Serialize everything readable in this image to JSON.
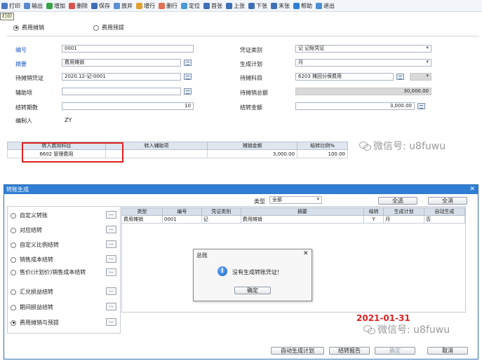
{
  "toolbar": {
    "items": [
      {
        "icon": "print-icon",
        "label": "打印",
        "color": "#4a78c2"
      },
      {
        "icon": "export-icon",
        "label": "输出",
        "color": "#5a88cf"
      },
      {
        "icon": "add-icon",
        "label": "增加",
        "color": "#3aa34a"
      },
      {
        "icon": "delete-icon",
        "label": "删除",
        "color": "#d9534f"
      },
      {
        "icon": "save-icon",
        "label": "保存",
        "color": "#3d6db5"
      },
      {
        "icon": "discard-icon",
        "label": "放弃",
        "color": "#5b8fd0"
      },
      {
        "icon": "add-row-icon",
        "label": "增行",
        "color": "#e0a030"
      },
      {
        "icon": "delete-row-icon",
        "label": "删行",
        "color": "#e07050"
      },
      {
        "icon": "locate-icon",
        "label": "定位",
        "color": "#4a9ad8"
      },
      {
        "icon": "first-icon",
        "label": "首张",
        "color": "#3f6fb8"
      },
      {
        "icon": "prev-icon",
        "label": "上张",
        "color": "#3f6fb8"
      },
      {
        "icon": "next-icon",
        "label": "下张",
        "color": "#3f6fb8"
      },
      {
        "icon": "last-icon",
        "label": "末张",
        "color": "#3f6fb8"
      },
      {
        "icon": "help-icon",
        "label": "帮助",
        "color": "#2d7fd4"
      },
      {
        "icon": "exit-icon",
        "label": "退出",
        "color": "#4a8fd4"
      }
    ],
    "tooltip": "打印"
  },
  "form": {
    "radio_amortize": "费用摊销",
    "radio_accrual": "费用预提",
    "labels": {
      "code": "编号",
      "summary": "摘要",
      "pending_voucher": "待摊销凭证",
      "aux": "辅助项",
      "periods": "结转期数",
      "maker": "编制人",
      "voucher_type": "凭证类别",
      "plan": "生成计划",
      "pending_subject": "待摊科目",
      "pending_total": "待摊销总额",
      "transfer_amount": "结转金额"
    },
    "values": {
      "code": "0001",
      "summary": "费用摊销",
      "pending_voucher": "2020.12-记-0001",
      "aux": "",
      "periods": "10",
      "maker": "ZY",
      "voucher_type": "记 记账凭证",
      "plan": "月",
      "pending_subject": "6203 摊回分保费用",
      "pending_total": "30,000.00",
      "transfer_amount": "3,000.00"
    }
  },
  "detail_grid": {
    "headers": [
      "转入费用科目",
      "转入辅助项",
      "摊销金额",
      "结转比例%"
    ],
    "rows": [
      [
        "6602 管理费用",
        "",
        "3,000.00",
        "100.00"
      ]
    ]
  },
  "watermark": "微信号: u8fuwu",
  "dialog": {
    "title": "转账生成",
    "type_label": "类型",
    "type_value": "全部",
    "select_all": "全选",
    "clear_all": "全消",
    "options": [
      {
        "label": "自定义转账",
        "checked": false
      },
      {
        "label": "对应结转",
        "checked": false
      },
      {
        "label": "自定义比例结转",
        "checked": false
      },
      {
        "label": "销售成本结转",
        "checked": false
      },
      {
        "label": "售价(计划价)销售成本结转",
        "checked": false
      },
      {
        "label": "汇兑损益结转",
        "checked": false
      },
      {
        "label": "期间损益结转",
        "checked": false
      },
      {
        "label": "费用摊销与预提",
        "checked": true
      }
    ],
    "grid_headers": [
      "类型",
      "编号",
      "凭证类别",
      "摘要",
      "结转",
      "生成计划",
      "自动生成"
    ],
    "grid_rows": [
      [
        "费用摊销",
        "0001",
        "记",
        "费用摊销",
        "Y",
        "月",
        "否"
      ]
    ],
    "date": "2021-01-31",
    "buttons": {
      "auto_plan": "自动生成计划",
      "report": "结转报告",
      "ok": "确定",
      "cancel": "取消"
    }
  },
  "msgbox": {
    "title": "总账",
    "message": "没有生成转账凭证!",
    "ok": "确定"
  }
}
